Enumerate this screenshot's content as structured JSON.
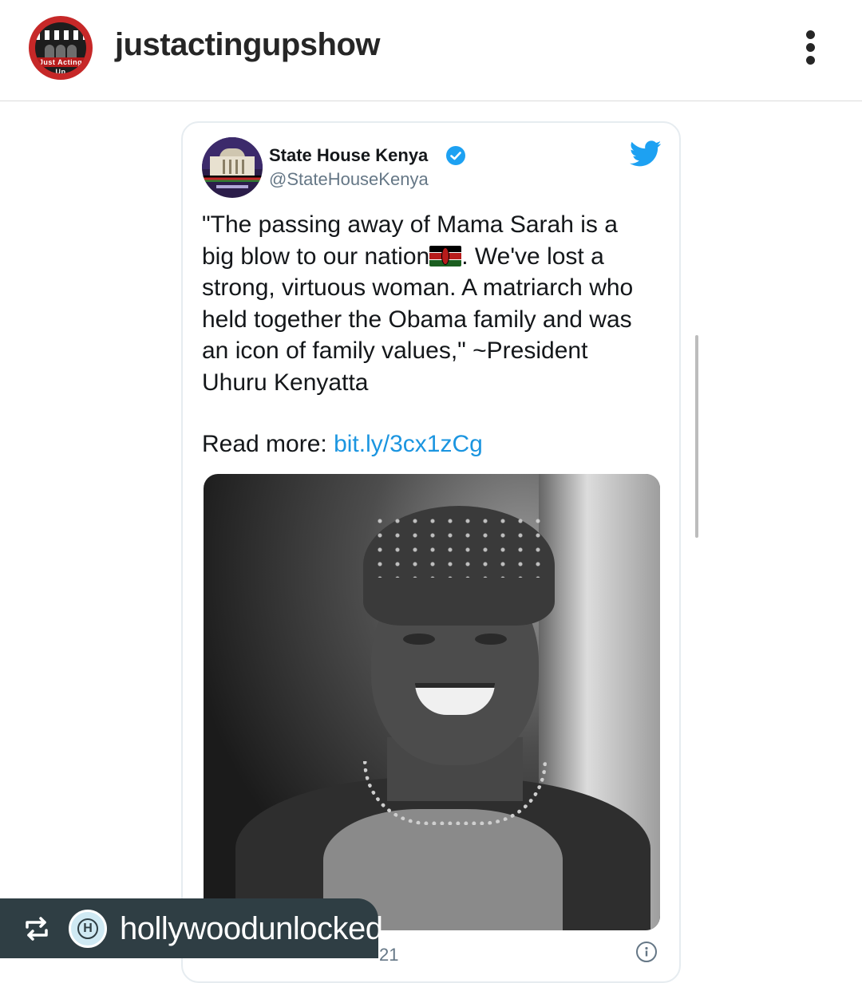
{
  "post": {
    "username": "justactingupshow",
    "avatar_text": "Just Acting Up",
    "more_icon": "more-vertical-icon"
  },
  "tweet": {
    "name": "State House Kenya",
    "handle": "@StateHouseKenya",
    "verified": true,
    "text_before_flag": "\"The passing away of Mama Sarah is a\nbig blow to our nation",
    "flag_emoji": "kenya-flag",
    "text_after_flag": ". We've lost a\nstrong, virtuous woman. A matriarch who\nheld together the Obama family and was\nan icon of family values,\" ~President\nUhuru Kenyatta",
    "read_more_label": "Read more: ",
    "read_more_link": "bit.ly/3cx1zCg",
    "date_partial": "21",
    "photo_alt": "Black and white portrait of Mama Sarah smiling, wearing a head wrap and beaded necklace"
  },
  "repost": {
    "username": "hollywoodunlocked",
    "icon": "repost-icon",
    "badge_letter": "H"
  },
  "colors": {
    "twitter_blue": "#1da1f2",
    "link_blue": "#1b95e0",
    "repost_bar": "#2f3e44"
  }
}
